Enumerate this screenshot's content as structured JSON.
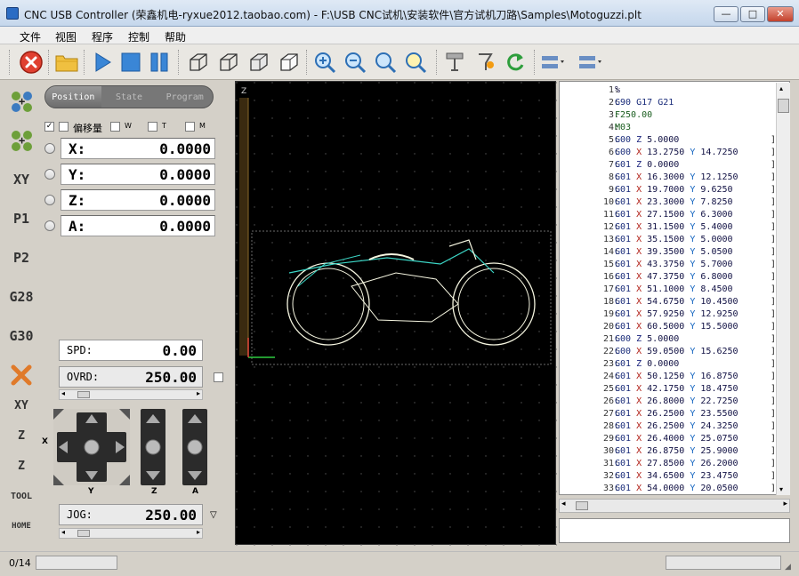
{
  "window": {
    "title": "CNC USB Controller (荣鑫机电-ryxue2012.taobao.com) - F:\\USB CNC试机\\安装软件\\官方试机刀路\\Samples\\Motoguzzi.plt",
    "controls": {
      "minimize": "—",
      "maximize": "□",
      "close": "✕"
    }
  },
  "menu": [
    "文件",
    "视图",
    "程序",
    "控制",
    "帮助"
  ],
  "toolbar_icons": [
    "stop-icon",
    "open-folder-icon",
    "play-icon",
    "stop-square-icon",
    "pause-icon",
    "view-iso-icon",
    "view-front-icon",
    "view-side-icon",
    "view-top-icon",
    "zoom-in-icon",
    "zoom-out-icon",
    "zoom-fit-icon",
    "zoom-window-icon",
    "tool-setup-icon",
    "probe-icon",
    "refresh-icon",
    "jog-x-icon",
    "jog-y-icon"
  ],
  "left_tools": [
    "",
    "",
    "XY",
    "P1",
    "P2",
    "G28",
    "G30",
    "",
    "XY",
    "Z",
    "Z",
    "TOOL",
    "HOME"
  ],
  "tabs": [
    {
      "label": "Position",
      "active": true
    },
    {
      "label": "State",
      "active": false
    },
    {
      "label": "Program",
      "active": false
    }
  ],
  "offset": {
    "label": "偏移量",
    "checked": true,
    "axes": [
      "W",
      "T",
      "M"
    ]
  },
  "coords": [
    {
      "axis": "X:",
      "value": "0.0000"
    },
    {
      "axis": "Y:",
      "value": "0.0000"
    },
    {
      "axis": "Z:",
      "value": "0.0000"
    },
    {
      "axis": "A:",
      "value": "0.0000"
    }
  ],
  "spd": {
    "label": "SPD:",
    "value": "0.00"
  },
  "ovrd": {
    "label": "OVRD:",
    "value": "250.00"
  },
  "jog": {
    "label": "JOG:",
    "value": "250.00"
  },
  "jog_labels": {
    "x": "X",
    "y": "Y",
    "z": "Z",
    "a": "A"
  },
  "canvas": {
    "axis_label": "Z"
  },
  "code_lines": [
    {
      "n": "1:",
      "t": "%"
    },
    {
      "n": "2:",
      "t": "G90 G17 G21"
    },
    {
      "n": "3:",
      "t": "F250.00"
    },
    {
      "n": "4:",
      "t": "M03"
    },
    {
      "n": "5:",
      "t": "G00 Z 5.0000"
    },
    {
      "n": "6:",
      "t": "G00 X 13.2750 Y 14.7250"
    },
    {
      "n": "7:",
      "t": "G01 Z 0.0000"
    },
    {
      "n": "8:",
      "t": "G01 X 16.3000 Y 12.1250"
    },
    {
      "n": "9:",
      "t": "G01 X 19.7000 Y 9.6250"
    },
    {
      "n": "10:",
      "t": "G01 X 23.3000 Y 7.8250"
    },
    {
      "n": "11:",
      "t": "G01 X 27.1500 Y 6.3000"
    },
    {
      "n": "12:",
      "t": "G01 X 31.1500 Y 5.4000"
    },
    {
      "n": "13:",
      "t": "G01 X 35.1500 Y 5.0000"
    },
    {
      "n": "14:",
      "t": "G01 X 39.3500 Y 5.0500"
    },
    {
      "n": "15:",
      "t": "G01 X 43.3750 Y 5.7000"
    },
    {
      "n": "16:",
      "t": "G01 X 47.3750 Y 6.8000"
    },
    {
      "n": "17:",
      "t": "G01 X 51.1000 Y 8.4500"
    },
    {
      "n": "18:",
      "t": "G01 X 54.6750 Y 10.4500"
    },
    {
      "n": "19:",
      "t": "G01 X 57.9250 Y 12.9250"
    },
    {
      "n": "20:",
      "t": "G01 X 60.5000 Y 15.5000"
    },
    {
      "n": "21:",
      "t": "G00 Z 5.0000"
    },
    {
      "n": "22:",
      "t": "G00 X 59.0500 Y 15.6250"
    },
    {
      "n": "23:",
      "t": "G01 Z 0.0000"
    },
    {
      "n": "24:",
      "t": "G01 X 50.1250 Y 16.8750"
    },
    {
      "n": "25:",
      "t": "G01 X 42.1750 Y 18.4750"
    },
    {
      "n": "26:",
      "t": "G01 X 26.8000 Y 22.7250"
    },
    {
      "n": "27:",
      "t": "G01 X 26.2500 Y 23.5500"
    },
    {
      "n": "28:",
      "t": "G01 X 26.2500 Y 24.3250"
    },
    {
      "n": "29:",
      "t": "G01 X 26.4000 Y 25.0750"
    },
    {
      "n": "30:",
      "t": "G01 X 26.8750 Y 25.9000"
    },
    {
      "n": "31:",
      "t": "G01 X 27.8500 Y 26.2000"
    },
    {
      "n": "32:",
      "t": "G01 X 34.6500 Y 23.4750"
    },
    {
      "n": "33:",
      "t": "G01 X 54.0000 Y 20.0500"
    }
  ],
  "status": {
    "progress": "0/14"
  }
}
